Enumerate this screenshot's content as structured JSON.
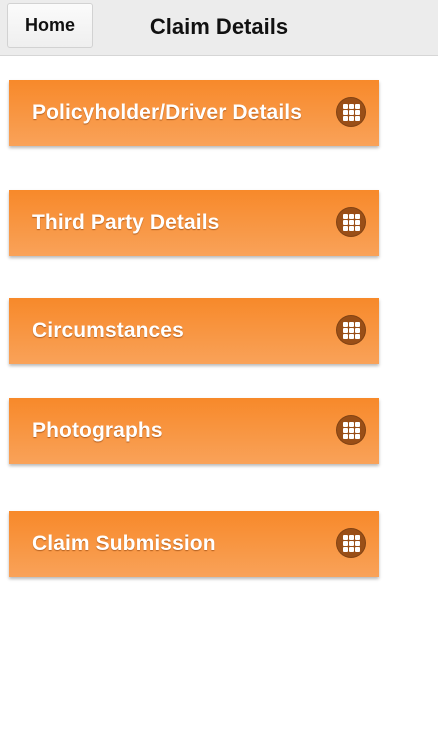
{
  "header": {
    "home_label": "Home",
    "title": "Claim Details"
  },
  "menu": {
    "items": [
      {
        "label": "Policyholder/Driver Details",
        "icon": "grid-icon"
      },
      {
        "label": "Third Party Details",
        "icon": "grid-icon"
      },
      {
        "label": "Circumstances",
        "icon": "grid-icon"
      },
      {
        "label": "Photographs",
        "icon": "grid-icon"
      },
      {
        "label": "Claim Submission",
        "icon": "grid-icon"
      }
    ]
  },
  "colors": {
    "accent": "#f7892a",
    "icon_bg": "#9a4f17",
    "header_bg": "#ececec"
  }
}
